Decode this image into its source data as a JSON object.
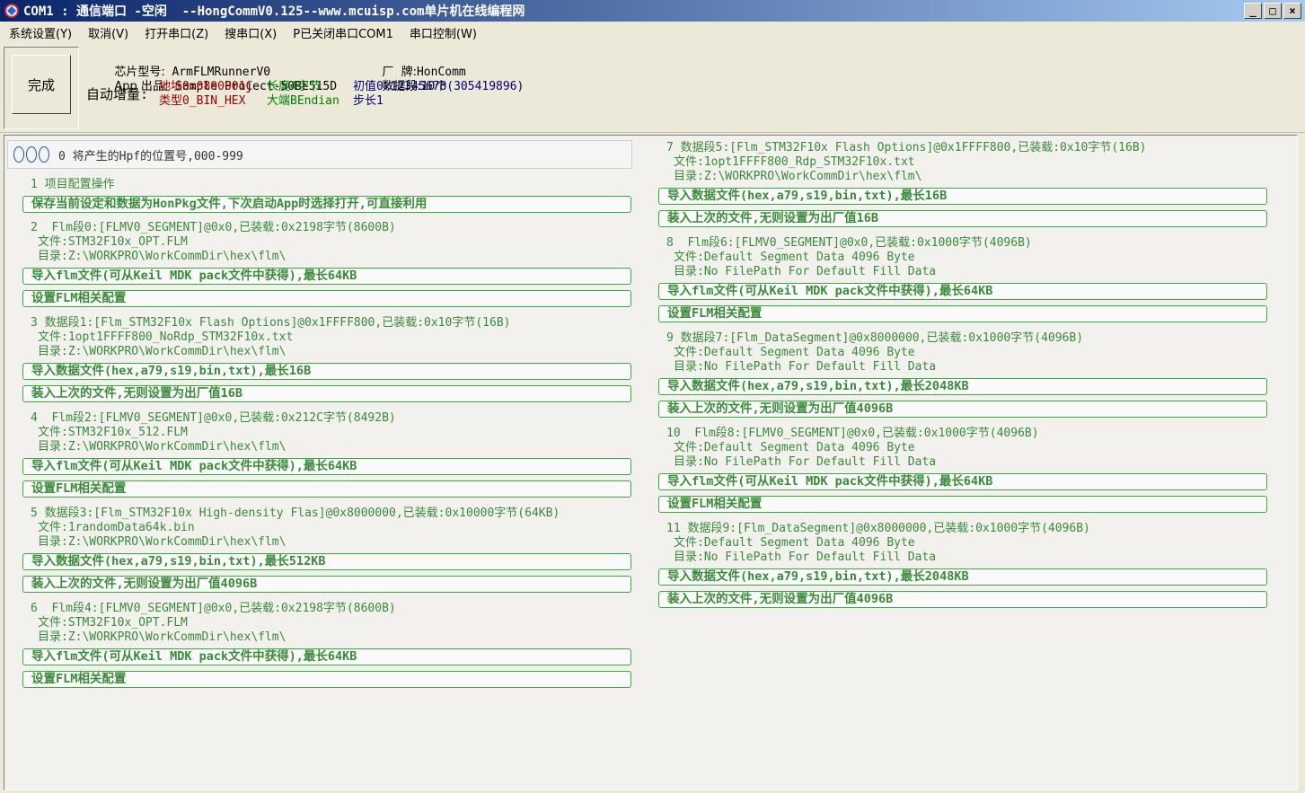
{
  "window": {
    "title": "COM1 : 通信端口 -空闲  --HongCommV0.125--www.mcuisp.com单片机在线编程网",
    "minimize": "_",
    "maximize": "□",
    "close": "×"
  },
  "menu": [
    "系统设置(Y)",
    "取消(V)",
    "打开串口(Z)",
    "搜串口(X)",
    "P已关闭串口COM1",
    "串口控制(W)"
  ],
  "done_label": "完成",
  "info": {
    "chip_label": "芯片型号:",
    "chip_value": "ArmFLMRunnerV0",
    "app_label": "App 出品:",
    "app_value": "Sample Project-50BE515D",
    "brand_label": "厂  牌:",
    "brand_value": "HonComm",
    "segcount_label": "数据段:",
    "segcount_value": "10个",
    "autoinc_label": "自动增量:",
    "addr": "地址0x0800001C",
    "length": "长度4字节",
    "init": "初值0x12345678(305419896)",
    "type": "类型0_BIN_HEX",
    "endian": "大端BEndian",
    "step": "步长1"
  },
  "header_text": "0 将产生的Hpf的位置号,000-999",
  "left_entries": [
    {
      "title": "1 项目配置操作",
      "subs": [],
      "buttons": [
        "保存当前设定和数据为HonPkg文件,下次启动App时选择打开,可直接利用"
      ]
    },
    {
      "title": "2  Flm段0:[FLMV0_SEGMENT]@0x0,已装载:0x2198字节(8600B)",
      "subs": [
        "文件:STM32F10x_OPT.FLM",
        "目录:Z:\\WORKPRO\\WorkCommDir\\hex\\flm\\"
      ],
      "buttons": [
        "导入flm文件(可从Keil MDK pack文件中获得),最长64KB",
        "设置FLM相关配置"
      ]
    },
    {
      "title": "3 数据段1:[Flm_STM32F10x Flash Options]@0x1FFFF800,已装载:0x10字节(16B)",
      "subs": [
        "文件:1opt1FFFF800_NoRdp_STM32F10x.txt",
        "目录:Z:\\WORKPRO\\WorkCommDir\\hex\\flm\\"
      ],
      "buttons": [
        "导入数据文件(hex,a79,s19,bin,txt),最长16B",
        "装入上次的文件,无则设置为出厂值16B"
      ]
    },
    {
      "title": "4  Flm段2:[FLMV0_SEGMENT]@0x0,已装载:0x212C字节(8492B)",
      "subs": [
        "文件:STM32F10x_512.FLM",
        "目录:Z:\\WORKPRO\\WorkCommDir\\hex\\flm\\"
      ],
      "buttons": [
        "导入flm文件(可从Keil MDK pack文件中获得),最长64KB",
        "设置FLM相关配置"
      ]
    },
    {
      "title": "5 数据段3:[Flm_STM32F10x High-density Flas]@0x8000000,已装载:0x10000字节(64KB)",
      "subs": [
        "文件:1randomData64k.bin",
        "目录:Z:\\WORKPRO\\WorkCommDir\\hex\\flm\\"
      ],
      "buttons": [
        "导入数据文件(hex,a79,s19,bin,txt),最长512KB",
        "装入上次的文件,无则设置为出厂值4096B"
      ]
    },
    {
      "title": "6  Flm段4:[FLMV0_SEGMENT]@0x0,已装载:0x2198字节(8600B)",
      "subs": [
        "文件:STM32F10x_OPT.FLM",
        "目录:Z:\\WORKPRO\\WorkCommDir\\hex\\flm\\"
      ],
      "buttons": [
        "导入flm文件(可从Keil MDK pack文件中获得),最长64KB",
        "设置FLM相关配置"
      ]
    }
  ],
  "right_entries": [
    {
      "title": "7 数据段5:[Flm_STM32F10x Flash Options]@0x1FFFF800,已装载:0x10字节(16B)",
      "subs": [
        "文件:1opt1FFFF800_Rdp_STM32F10x.txt",
        "目录:Z:\\WORKPRO\\WorkCommDir\\hex\\flm\\"
      ],
      "buttons": [
        "导入数据文件(hex,a79,s19,bin,txt),最长16B",
        "装入上次的文件,无则设置为出厂值16B"
      ]
    },
    {
      "title": "8  Flm段6:[FLMV0_SEGMENT]@0x0,已装载:0x1000字节(4096B)",
      "subs": [
        "文件:Default Segment Data 4096 Byte",
        "目录:No FilePath For Default Fill Data"
      ],
      "buttons": [
        "导入flm文件(可从Keil MDK pack文件中获得),最长64KB",
        "设置FLM相关配置"
      ]
    },
    {
      "title": "9 数据段7:[Flm_DataSegment]@0x8000000,已装载:0x1000字节(4096B)",
      "subs": [
        "文件:Default Segment Data 4096 Byte",
        "目录:No FilePath For Default Fill Data"
      ],
      "buttons": [
        "导入数据文件(hex,a79,s19,bin,txt),最长2048KB",
        "装入上次的文件,无则设置为出厂值4096B"
      ]
    },
    {
      "title": "10  Flm段8:[FLMV0_SEGMENT]@0x0,已装载:0x1000字节(4096B)",
      "subs": [
        "文件:Default Segment Data 4096 Byte",
        "目录:No FilePath For Default Fill Data"
      ],
      "buttons": [
        "导入flm文件(可从Keil MDK pack文件中获得),最长64KB",
        "设置FLM相关配置"
      ]
    },
    {
      "title": "11 数据段9:[Flm_DataSegment]@0x8000000,已装载:0x1000字节(4096B)",
      "subs": [
        "文件:Default Segment Data 4096 Byte",
        "目录:No FilePath For Default Fill Data"
      ],
      "buttons": [
        "导入数据文件(hex,a79,s19,bin,txt),最长2048KB",
        "装入上次的文件,无则设置为出厂值4096B"
      ]
    }
  ],
  "colors": {
    "entry_text": "#3a8a3a",
    "button_border": "#3aaa3a",
    "title_bar": "#0a246a"
  }
}
